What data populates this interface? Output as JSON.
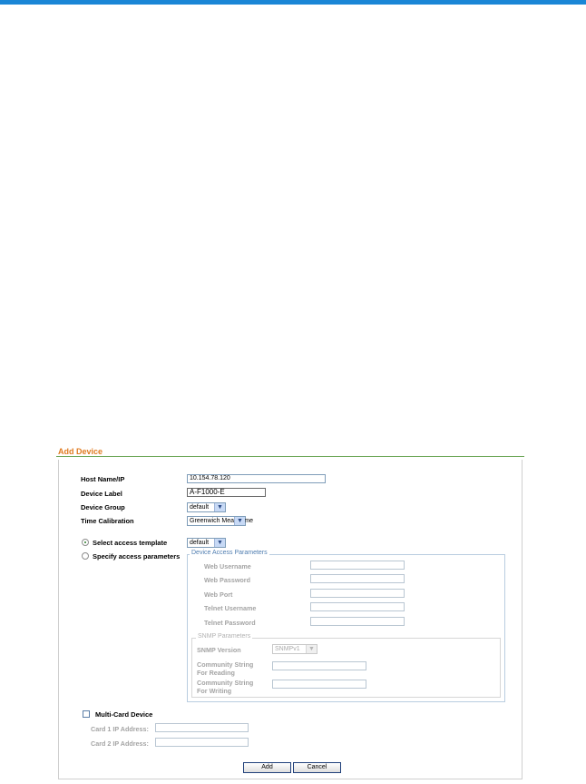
{
  "panel": {
    "title": "Add Device"
  },
  "form": {
    "host_name_label": "Host Name/IP",
    "host_name_value": "10.154.78.120",
    "device_label_label": "Device Label",
    "device_label_value": "A-F1000-E",
    "device_group_label": "Device Group",
    "device_group_value": "default",
    "time_calibration_label": "Time Calibration",
    "time_calibration_value": "Greenwich Mean Time",
    "select_template_label": "Select access template",
    "select_template_value": "default",
    "specify_params_label": "Specify access parameters"
  },
  "access_params": {
    "legend": "Device Access Parameters",
    "web_username_label": "Web Username",
    "web_password_label": "Web Password",
    "web_port_label": "Web Port",
    "telnet_username_label": "Telnet Username",
    "telnet_password_label": "Telnet Password"
  },
  "snmp": {
    "legend": "SNMP Parameters",
    "version_label": "SNMP Version",
    "version_value": "SNMPv1",
    "read_label_1": "Community String",
    "read_label_2": "For Reading",
    "write_label_1": "Community String",
    "write_label_2": "For Writing"
  },
  "multicard": {
    "checkbox_label": "Multi-Card Device",
    "card1_label": "Card 1 IP Address:",
    "card2_label": "Card 2 IP Address:"
  },
  "buttons": {
    "add": "Add",
    "cancel": "Cancel"
  },
  "colors": {
    "top_bar": "#1a86d6",
    "title": "#e07a1f",
    "title_rule": "#6fa85a"
  },
  "icons": {
    "dropdown": "chevron-down-icon",
    "radio": "radio-icon",
    "checkbox": "checkbox-icon"
  }
}
